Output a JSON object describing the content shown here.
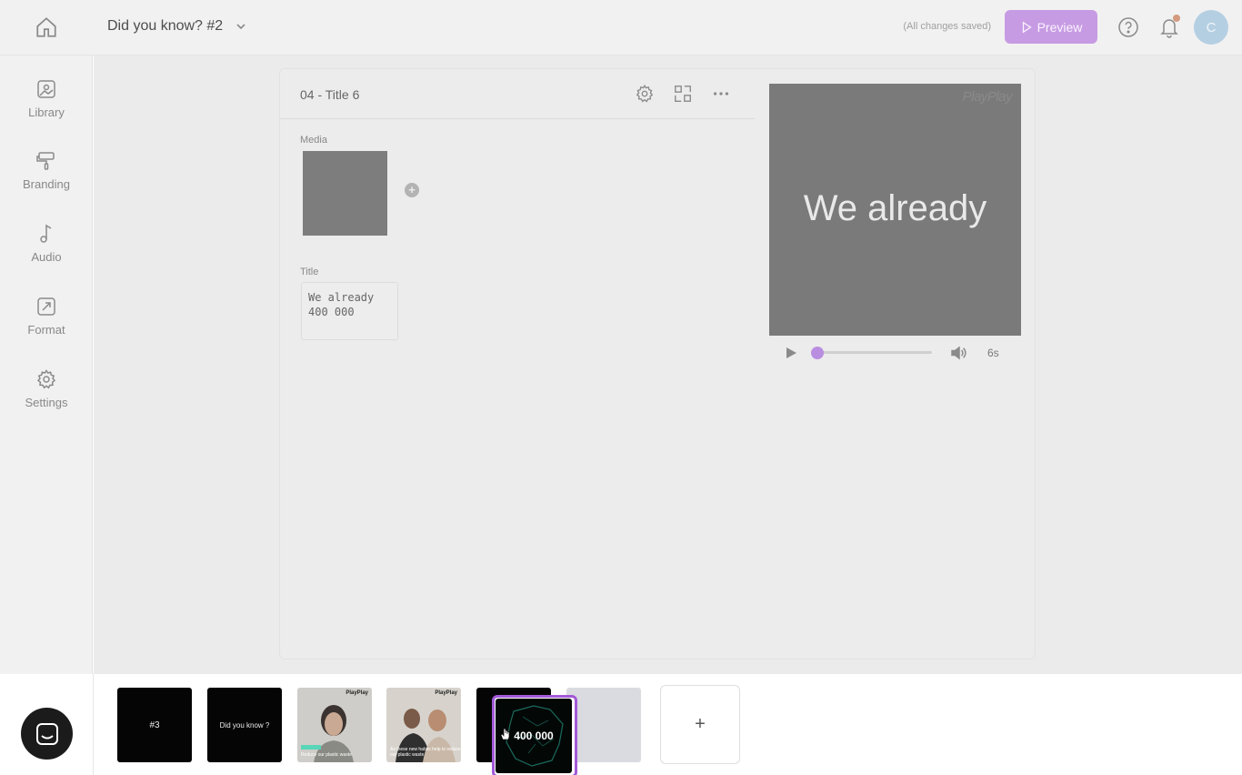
{
  "header": {
    "home_icon": "home-icon",
    "project_title": "Did you know? #2",
    "save_status": "(All changes saved)",
    "preview_label": "Preview",
    "avatar_initial": "C",
    "accent_color": "#c79be3"
  },
  "sidebar": {
    "items": [
      {
        "label": "Library",
        "icon": "image-icon"
      },
      {
        "label": "Branding",
        "icon": "paint-roller-icon"
      },
      {
        "label": "Audio",
        "icon": "music-note-icon"
      },
      {
        "label": "Format",
        "icon": "resize-icon"
      },
      {
        "label": "Settings",
        "icon": "gear-icon"
      }
    ]
  },
  "editor": {
    "scene_title": "04 - Title 6",
    "media_label": "Media",
    "title_label": "Title",
    "title_value": "We already\n400 000"
  },
  "preview": {
    "watermark": "PlayPlay",
    "overlay_text": "We already",
    "duration": "6s",
    "progress_fraction": 0.0
  },
  "timeline": {
    "slides": [
      {
        "text": "#3",
        "kind": "dark"
      },
      {
        "text": "Did you know ?",
        "kind": "dark"
      },
      {
        "kind": "photo",
        "logo": "PlayPlay",
        "caption": "Reduce our plastic waste"
      },
      {
        "kind": "photo",
        "logo": "PlayPlay",
        "caption": "As these new habits help to reduce our plastic waste"
      },
      {
        "kind": "dark"
      },
      {
        "kind": "empty"
      }
    ],
    "selected_text": "400 000",
    "add_label": "+"
  }
}
